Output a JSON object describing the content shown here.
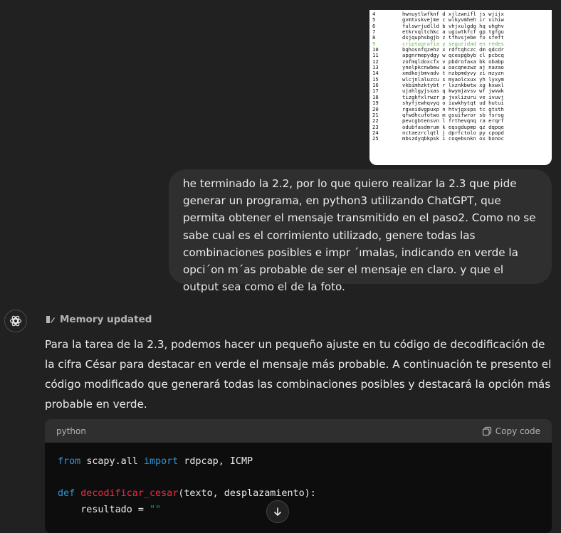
{
  "attachment": {
    "rows": [
      {
        "n": "4",
        "t": "hwnuytlwfknf d xjlzwnifl js wjijx"
      },
      {
        "n": "5",
        "t": "gvmtxskvejme c wlkyvmheh ir vihiw"
      },
      {
        "n": "6",
        "t": "fulswrjudlld b vhjxulgdg hq uhghv"
      },
      {
        "n": "7",
        "t": "etkrvqltchkc a ugiwtkfcf gp tgfgu"
      },
      {
        "n": "8",
        "t": "dsjquphsbgjb z tfhvsjebe fo sfeft"
      },
      {
        "n": "9",
        "t": "criptografia y seguridad en redes"
      },
      {
        "n": "10",
        "t": "bqhosnfqzehz x rdftqhczc dm qdcdr"
      },
      {
        "n": "11",
        "t": "apgnrmepydgy w qcespgbyb cl pcbcq"
      },
      {
        "n": "12",
        "t": "zofmqldoxcfx v pbdrofaxa bk obabp"
      },
      {
        "n": "13",
        "t": "ynelpkcnwbew u oacqnezwz aj nazao"
      },
      {
        "n": "14",
        "t": "xmdkojbmvadv t nzbpmdyvy zi mzyzn"
      },
      {
        "n": "15",
        "t": "wlcjnlaluzcu s myaolcxux yh lyxym"
      },
      {
        "n": "16",
        "t": "vkbimhzktybt r lxznkbwtw xg kxwxl"
      },
      {
        "n": "17",
        "t": "ujahlgyjsxas q kwymjavsv wf jwvwk"
      },
      {
        "n": "18",
        "t": "tizgkfxlrwzr p jvxlizuru ve ivuvj"
      },
      {
        "n": "19",
        "t": "shyfjewhqvyq o iuwkhytqt ud hutui"
      },
      {
        "n": "20",
        "t": "rgxeidvgpuxp n htvjgxsps tc gtsth"
      },
      {
        "n": "21",
        "t": "qfwdhcufotwo m gsuifwror sb fsrsg"
      },
      {
        "n": "22",
        "t": "pevcgbtensvn l frthevqnq ra erqrf"
      },
      {
        "n": "23",
        "t": "odubfasdmrum k eqsgdupmp qz dqpqe"
      },
      {
        "n": "24",
        "t": "nctaezrclqtl j dprfctolo py cpopd"
      },
      {
        "n": "25",
        "t": "mbszdyqbkpsk i coqebsnkn ox bonoc"
      }
    ],
    "highlight_row": 5,
    "highlight_color": "#5dbb3c"
  },
  "user_message": "he terminado la 2.2, por lo que quiero realizar la 2.3 que pide generar un programa, en python3 utilizando ChatGPT, que permita obtener el mensaje transmitido en el paso2. Como no se sabe cual es el corrimiento utilizado, genere todas las combinaciones posibles e impr ´ımalas, indicando en verde la opci´on m´as probable de ser el mensaje en claro. y que el output sea como el de la foto.",
  "memory_label": "Memory updated",
  "assistant_message": "Para la tarea de la 2.3, podemos hacer un pequeño ajuste en tu código de decodificación de la cifra César para destacar en verde el mensaje más probable. A continuación te presento el código modificado que generará todas las combinaciones posibles y destacará la opción más probable en verde.",
  "code": {
    "language": "python",
    "copy_label": "Copy code",
    "line1": {
      "kw1": "from",
      "mod": "scapy.all",
      "kw2": "import",
      "rest": "rdpcap, ICMP"
    },
    "line3": {
      "kw": "def",
      "fn": "decodificar_cesar",
      "args": "(texto, desplazamiento):"
    },
    "line4": {
      "lhs": "    resultado = ",
      "str": "\"\""
    }
  },
  "colors": {
    "bg": "#212121",
    "bubble": "#2f2f2f",
    "code_bg": "#0d0d0d",
    "keyword": "#2e95d3",
    "function": "#f22c3d",
    "string": "#00a67d",
    "module": "#df3079"
  }
}
